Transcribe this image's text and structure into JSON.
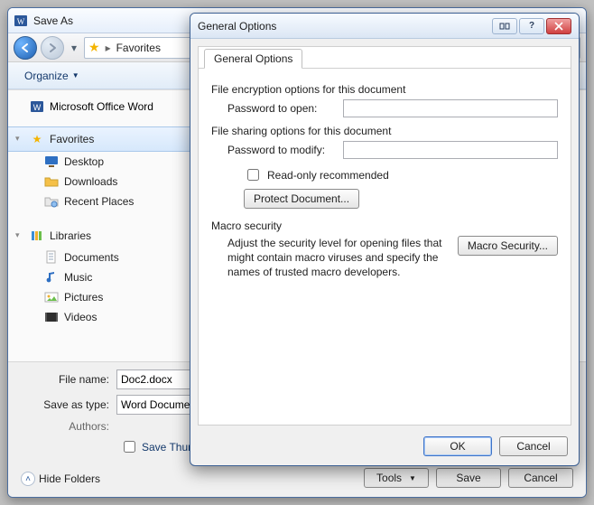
{
  "saveas": {
    "title": "Save As",
    "breadcrumb": {
      "location": "Favorites"
    },
    "organize_label": "Organize",
    "top_link": "Microsoft Office Word",
    "groups": {
      "favorites": {
        "label": "Favorites",
        "items": [
          {
            "label": "Desktop"
          },
          {
            "label": "Downloads"
          },
          {
            "label": "Recent Places"
          }
        ]
      },
      "libraries": {
        "label": "Libraries",
        "items": [
          {
            "label": "Documents"
          },
          {
            "label": "Music"
          },
          {
            "label": "Pictures"
          },
          {
            "label": "Videos"
          }
        ]
      }
    },
    "file_name_label": "File name:",
    "file_name_value": "Doc2.docx",
    "save_type_label": "Save as type:",
    "save_type_value": "Word Document",
    "authors_label": "Authors:",
    "save_thumbnail_label": "Save Thumbnail",
    "hide_folders_label": "Hide Folders",
    "tools_label": "Tools",
    "save_label": "Save",
    "cancel_label": "Cancel"
  },
  "genopt": {
    "title": "General Options",
    "tab_label": "General Options",
    "enc_section": "File encryption options for this document",
    "pwd_open_label": "Password to open:",
    "share_section": "File sharing options for this document",
    "pwd_modify_label": "Password to modify:",
    "readonly_label": "Read-only recommended",
    "protect_doc_label": "Protect Document...",
    "macro_section": "Macro security",
    "macro_text": "Adjust the security level for opening files that might contain macro viruses and specify the names of trusted macro developers.",
    "macro_btn": "Macro Security...",
    "ok_label": "OK",
    "cancel_label": "Cancel"
  }
}
